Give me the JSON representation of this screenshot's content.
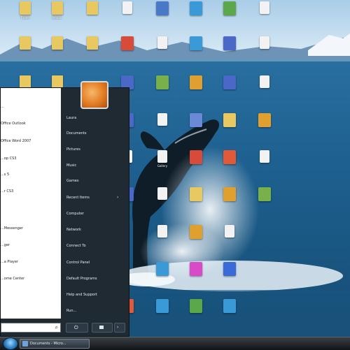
{
  "desktop": {
    "icons": [
      {
        "label": "Folder",
        "icon": "folder-icon",
        "color": "#e8c860"
      },
      {
        "label": "Adobe..",
        "icon": "folder-icon",
        "color": "#e8c860"
      },
      {
        "label": "",
        "icon": "folder-icon",
        "color": "#e8c860"
      },
      {
        "label": "",
        "icon": "document-icon",
        "color": "#f2f2f2"
      },
      {
        "label": "",
        "icon": "application-icon",
        "color": "#4a78c8"
      },
      {
        "label": "",
        "icon": "application-icon",
        "color": "#3a9ad8"
      },
      {
        "label": "",
        "icon": "application-icon",
        "color": "#5aa84a"
      },
      {
        "label": "",
        "icon": "document-icon",
        "color": "#f2f2f2"
      },
      {
        "label": "",
        "icon": "folder-icon",
        "color": "#e8c860"
      },
      {
        "label": "",
        "icon": "folder-icon",
        "color": "#e8c860"
      },
      {
        "label": "",
        "icon": "folder-icon",
        "color": "#e8c860"
      },
      {
        "label": "",
        "icon": "application-icon",
        "color": "#d84a3a"
      },
      {
        "label": "",
        "icon": "document-icon",
        "color": "#f2f2f2"
      },
      {
        "label": "",
        "icon": "application-icon",
        "color": "#3a9ad8"
      },
      {
        "label": "",
        "icon": "application-icon",
        "color": "#4a68c8"
      },
      {
        "label": "",
        "icon": "document-icon",
        "color": "#f2f2f2"
      },
      {
        "label": "",
        "icon": "folder-icon",
        "color": "#e8c860"
      },
      {
        "label": "",
        "icon": "folder-icon",
        "color": "#e8c860"
      },
      {
        "label": "",
        "icon": "application-icon",
        "color": "#4a68c8"
      },
      {
        "label": "",
        "icon": "application-icon",
        "color": "#7ab04a"
      },
      {
        "label": "",
        "icon": "application-icon",
        "color": "#e0a030"
      },
      {
        "label": "",
        "icon": "application-icon",
        "color": "#4a68c8"
      },
      {
        "label": "",
        "icon": "document-icon",
        "color": "#f2f2f2"
      },
      {
        "label": "",
        "icon": "application-icon",
        "color": "#4a68c8"
      },
      {
        "label": "",
        "icon": "document-icon",
        "color": "#f2f2f2"
      },
      {
        "label": "",
        "icon": "application-icon",
        "color": "#6a8ad8"
      },
      {
        "label": "",
        "icon": "application-icon",
        "color": "#e8c860"
      },
      {
        "label": "",
        "icon": "application-icon",
        "color": "#e0a030"
      },
      {
        "label": "",
        "icon": "document-icon",
        "color": "#f2f2f2"
      },
      {
        "label": "Gallery",
        "icon": "document-icon",
        "color": "#f2f2f2"
      },
      {
        "label": "",
        "icon": "application-icon",
        "color": "#d84a3a"
      },
      {
        "label": "",
        "icon": "application-icon",
        "color": "#e05a3a"
      },
      {
        "label": "",
        "icon": "document-icon",
        "color": "#f2f2f2"
      },
      {
        "label": "",
        "icon": "application-icon",
        "color": "#4a68c8"
      },
      {
        "label": "",
        "icon": "document-icon",
        "color": "#f2f2f2"
      },
      {
        "label": "",
        "icon": "application-icon",
        "color": "#e8c860"
      },
      {
        "label": "",
        "icon": "application-icon",
        "color": "#e0a030"
      },
      {
        "label": "",
        "icon": "application-icon",
        "color": "#7ab04a"
      },
      {
        "label": "",
        "icon": "document-icon",
        "color": "#f2f2f2"
      },
      {
        "label": "",
        "icon": "application-icon",
        "color": "#e0a030"
      },
      {
        "label": "",
        "icon": "document-icon",
        "color": "#f2f2f2"
      },
      {
        "label": "",
        "icon": "application-icon",
        "color": "#3a9ad8"
      },
      {
        "label": "",
        "icon": "application-icon",
        "color": "#d84ac8"
      },
      {
        "label": "",
        "icon": "application-icon",
        "color": "#3a6ad8"
      },
      {
        "label": "",
        "icon": "application-icon",
        "color": "#e05a3a"
      },
      {
        "label": "",
        "icon": "application-icon",
        "color": "#3a9ad8"
      },
      {
        "label": "",
        "icon": "application-icon",
        "color": "#5aa84a"
      },
      {
        "label": "",
        "icon": "application-icon",
        "color": "#3a9ad8"
      }
    ]
  },
  "start_menu": {
    "programs": [
      {
        "label": "..."
      },
      {
        "label": "Office Outlook"
      },
      {
        "label": "Office Word 2007"
      },
      {
        "label": "...op CS3"
      },
      {
        "label": "...s 5"
      },
      {
        "label": "...r CS3"
      },
      {
        "label": "...Messenger"
      },
      {
        "label": "...ger"
      },
      {
        "label": "...a Player"
      },
      {
        "label": "...ome Center"
      }
    ],
    "places": [
      {
        "label": "Laura"
      },
      {
        "label": "Documents"
      },
      {
        "label": "Pictures"
      },
      {
        "label": "Music"
      },
      {
        "label": "Games"
      },
      {
        "label": "Recent Items"
      },
      {
        "label": "Computer"
      },
      {
        "label": "Network"
      },
      {
        "label": "Connect To"
      },
      {
        "label": "Control Panel"
      },
      {
        "label": "Default Programs"
      },
      {
        "label": "Help and Support"
      },
      {
        "label": "Run..."
      }
    ],
    "recent_items_arrow": "›",
    "search_icon": "⌕",
    "power_icon": "⏻",
    "lock_arrow_icon": "›"
  },
  "taskbar": {
    "task_label": "Documents - Micro..."
  }
}
